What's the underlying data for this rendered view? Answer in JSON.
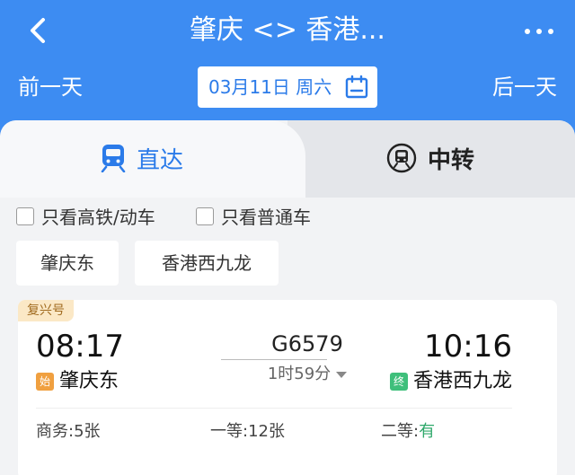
{
  "header": {
    "title": "肇庆 <> 香港...",
    "prev_day": "前一天",
    "next_day": "后一天",
    "date": "03月11日 周六",
    "colors": {
      "primary": "#3d8cf2",
      "accent": "#2b7be9"
    }
  },
  "tabs": [
    {
      "label": "直达",
      "icon": "train-icon",
      "active": true
    },
    {
      "label": "中转",
      "icon": "transfer-train-icon",
      "active": false
    }
  ],
  "filters": [
    {
      "label": "只看高铁/动车",
      "checked": false
    },
    {
      "label": "只看普通车",
      "checked": false
    }
  ],
  "stations": [
    "肇庆东",
    "香港西九龙"
  ],
  "train": {
    "badge": "复兴号",
    "number": "G6579",
    "duration": "1时59分",
    "depart_time": "08:17",
    "arrive_time": "10:16",
    "depart_tag": "始",
    "arrive_tag": "终",
    "depart_station": "肇庆东",
    "arrive_station": "香港西九龙",
    "seats": [
      {
        "label": "商务:",
        "value": "5张"
      },
      {
        "label": "一等:",
        "value": "12张"
      },
      {
        "label": "二等:",
        "value": "有"
      }
    ]
  }
}
